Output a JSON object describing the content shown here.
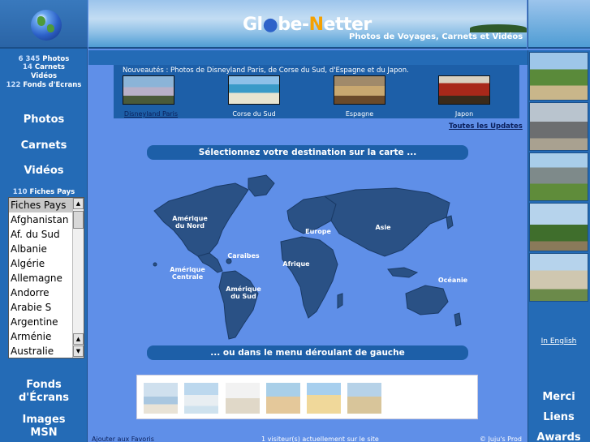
{
  "stats": {
    "photos_count": "6 345",
    "photos_label": "Photos",
    "carnets_count": "14",
    "carnets_label": "Carnets",
    "videos_label": "Vidéos",
    "fonds_count": "122",
    "fonds_label": "Fonds d'Ecrans"
  },
  "left_nav": {
    "photos": "Photos",
    "carnets": "Carnets",
    "videos": "Vidéos",
    "fonds_line1": "Fonds",
    "fonds_line2": "d'Écrans",
    "images_line1": "Images",
    "images_line2": "MSN"
  },
  "fiches": {
    "count": "110",
    "label": "Fiches Pays"
  },
  "country_list": [
    "Fiches Pays",
    "Afghanistan",
    "Af. du Sud",
    "Albanie",
    "Algérie",
    "Allemagne",
    "Andorre",
    "Arabie S",
    "Argentine",
    "Arménie",
    "Australie"
  ],
  "header": {
    "logo_part1": "Gl",
    "logo_part2": "be-",
    "logo_part3": "N",
    "logo_part4": "etter",
    "tagline": "Photos de Voyages, Carnets et Vidéos"
  },
  "updates": {
    "text": "Nouveautés : Photos de Disneyland Paris, de Corse du Sud, d'Espagne et du Japon.",
    "items": [
      "Disneyland Paris",
      "Corse du Sud",
      "Espagne",
      "Japon"
    ],
    "all_link": "Toutes les Updates"
  },
  "map": {
    "select_title": "Sélectionnez votre destination sur la carte ...",
    "menu_title": "... ou dans le menu déroulant de gauche",
    "regions": {
      "amn1": "Amérique",
      "amn2": "du Nord",
      "europe": "Europe",
      "asie": "Asie",
      "caraibes": "Caraibes",
      "afrique": "Afrique",
      "amc1": "Amérique",
      "amc2": "Centrale",
      "ams1": "Amérique",
      "ams2": "du Sud",
      "oceanie": "Océanie"
    }
  },
  "right_nav": {
    "in_english": "In English",
    "merci": "Merci",
    "liens": "Liens",
    "awards": "Awards"
  },
  "footer": {
    "favoris": "Ajouter aux Favoris",
    "visitors": "1 visiteur(s) actuellement sur le site",
    "credit": "© Juju's Prod"
  },
  "colors": {
    "page_bg": "#5f8fe8",
    "column_bg": "#246bb6",
    "banner_bg": "#1d5fa8",
    "map_land": "#2a5185",
    "logo_accent": "#f5a100"
  },
  "icons": [
    "globe-icon",
    "scroll-up-icon",
    "scroll-down-icon"
  ]
}
